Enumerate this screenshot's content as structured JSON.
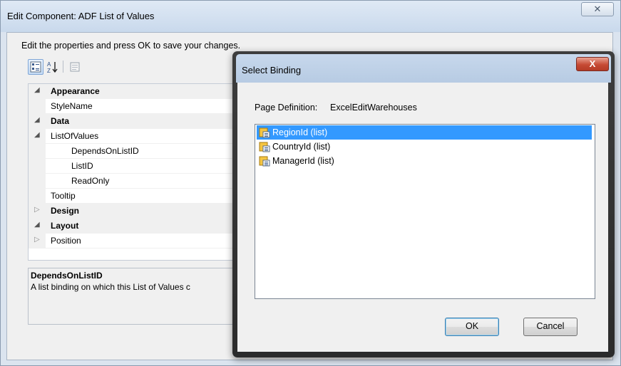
{
  "outer_window": {
    "title": "Edit Component: ADF List of Values",
    "close_glyph": "✕",
    "instructions": "Edit the properties and press OK to save your changes.",
    "toolbar": {
      "categorized_icon": "categorized-view-icon",
      "alphabetical_icon": "sort-alphabetical-icon",
      "alphabetical_glyph_top": "A",
      "alphabetical_glyph_bottom": "Z",
      "pages_icon": "property-pages-icon"
    },
    "property_grid": {
      "rows": [
        {
          "label": "Appearance",
          "type": "category",
          "expanded": true
        },
        {
          "label": "StyleName",
          "type": "property",
          "indent": 0
        },
        {
          "label": "Data",
          "type": "category",
          "expanded": true
        },
        {
          "label": "ListOfValues",
          "type": "group",
          "expanded": true
        },
        {
          "label": "DependsOnListID",
          "type": "property",
          "indent": 2
        },
        {
          "label": "ListID",
          "type": "property",
          "indent": 2
        },
        {
          "label": "ReadOnly",
          "type": "property",
          "indent": 2
        },
        {
          "label": "Tooltip",
          "type": "property",
          "indent": 0
        },
        {
          "label": "Design",
          "type": "category",
          "expanded": false
        },
        {
          "label": "Layout",
          "type": "category",
          "expanded": true
        },
        {
          "label": "Position",
          "type": "group",
          "expanded": false
        }
      ]
    },
    "description": {
      "title": "DependsOnListID",
      "text": "A list binding on which this List of Values c"
    }
  },
  "dialog": {
    "title": "Select Binding",
    "close_glyph": "X",
    "page_definition_label": "Page Definition:",
    "page_definition_value": "ExcelEditWarehouses",
    "bindings": [
      {
        "label": "RegionId (list)",
        "icon": "list-binding-icon",
        "selected": true
      },
      {
        "label": "CountryId (list)",
        "icon": "list-binding-icon",
        "selected": false
      },
      {
        "label": "ManagerId (list)",
        "icon": "list-binding-icon",
        "selected": false
      }
    ],
    "ok_label": "OK",
    "cancel_label": "Cancel"
  },
  "colors": {
    "selection": "#3399ff",
    "close_button_red": "#c64a34",
    "title_bar": "#c9d9ec"
  }
}
